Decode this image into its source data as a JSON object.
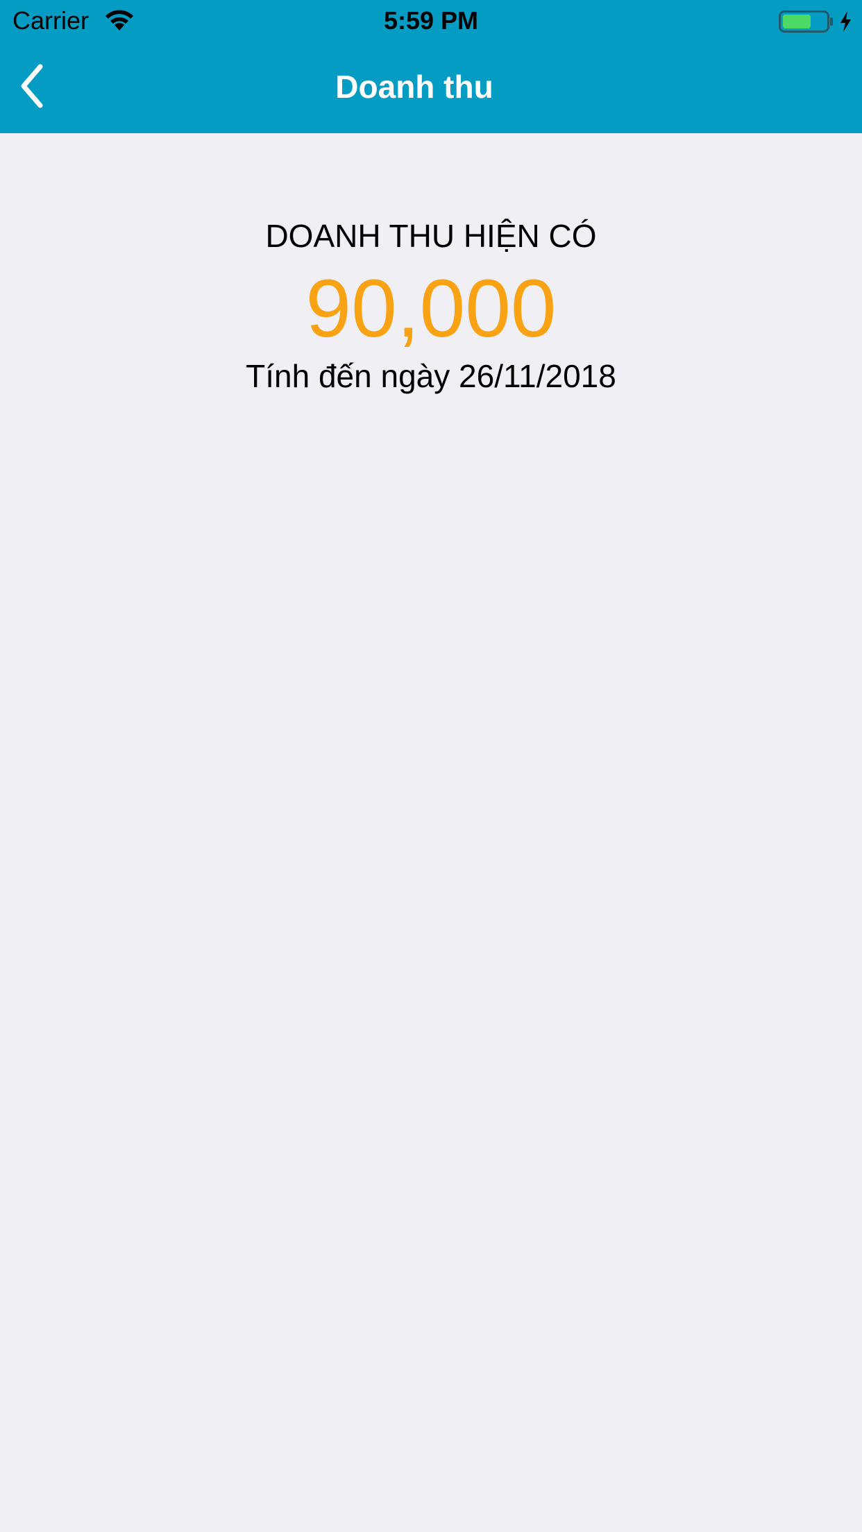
{
  "status_bar": {
    "carrier": "Carrier",
    "time": "5:59 PM",
    "wifi_icon": "wifi-icon",
    "battery_icon": "battery-icon",
    "charging_icon": "charging-bolt-icon",
    "battery_level": 0.65,
    "battery_color": "#4cd964"
  },
  "nav": {
    "title": "Doanh thu",
    "back_icon": "chevron-left-icon",
    "background_color": "#049cc3"
  },
  "revenue": {
    "label": "DOANH THU HIỆN CÓ",
    "amount": "90,000",
    "amount_color": "#f9a214",
    "date_text": "Tính đến ngày 26/11/2018"
  }
}
